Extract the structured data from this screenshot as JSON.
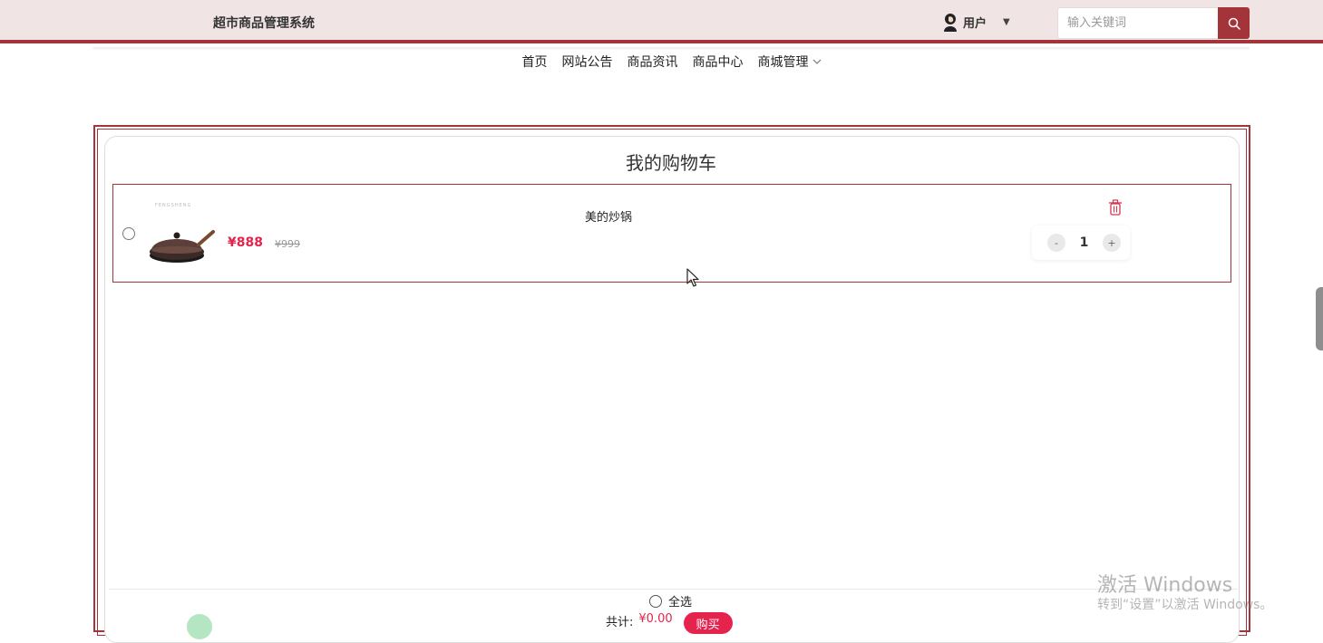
{
  "header": {
    "app_title": "超市商品管理系统",
    "user_label": "用户",
    "search_placeholder": "输入关键词"
  },
  "nav": {
    "items": [
      {
        "label": "首页"
      },
      {
        "label": "网站公告"
      },
      {
        "label": "商品资讯"
      },
      {
        "label": "商品中心"
      },
      {
        "label": "商城管理",
        "has_dropdown": true
      }
    ]
  },
  "cart": {
    "title": "我的购物车",
    "items": [
      {
        "name": "美的炒锅",
        "price": "¥888",
        "original_price": "¥999",
        "quantity": "1",
        "image_brand_text": "FENGSHENG",
        "selected": false
      }
    ],
    "qty_minus": "-",
    "qty_plus": "+",
    "select_all_label": "全选",
    "total_label": "共计:",
    "total_value": "¥0.00",
    "buy_label": "购买"
  },
  "watermark": {
    "line1": "激活 Windows",
    "line2": "转到“设置”以激活 Windows。"
  },
  "colors": {
    "brand": "#a3343a",
    "header_bg": "#f1e4e5",
    "price": "#e4244c"
  },
  "icons": {
    "search": "search-icon",
    "user": "user-avatar-icon",
    "caret": "caret-down-icon",
    "trash": "trash-icon",
    "chevron": "chevron-down-icon"
  }
}
